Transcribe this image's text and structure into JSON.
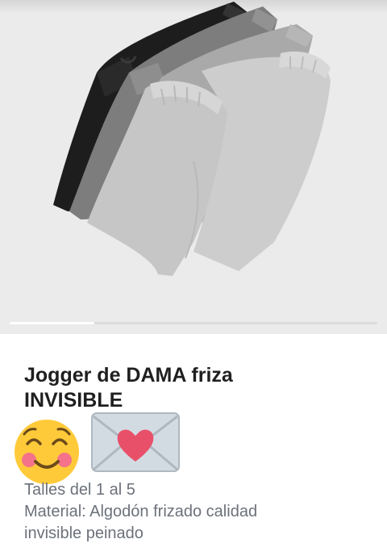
{
  "product": {
    "title_line1": "Jogger de DAMA friza",
    "title_line2": "INVISIBLE",
    "description_line1": "Talles del 1 al 5",
    "description_line2": "Material: Algodón frizado calidad",
    "description_line3": "invisible peinado"
  },
  "gallery": {
    "image_name": "jogger-pants-photo",
    "carousel_progress": 0.23
  },
  "icons": [
    "smiling-face-icon",
    "love-letter-icon"
  ],
  "colors": {
    "gallery_bg": "#ebebeb",
    "title_text": "#1f1f1f",
    "desc_text": "#6c717a"
  }
}
